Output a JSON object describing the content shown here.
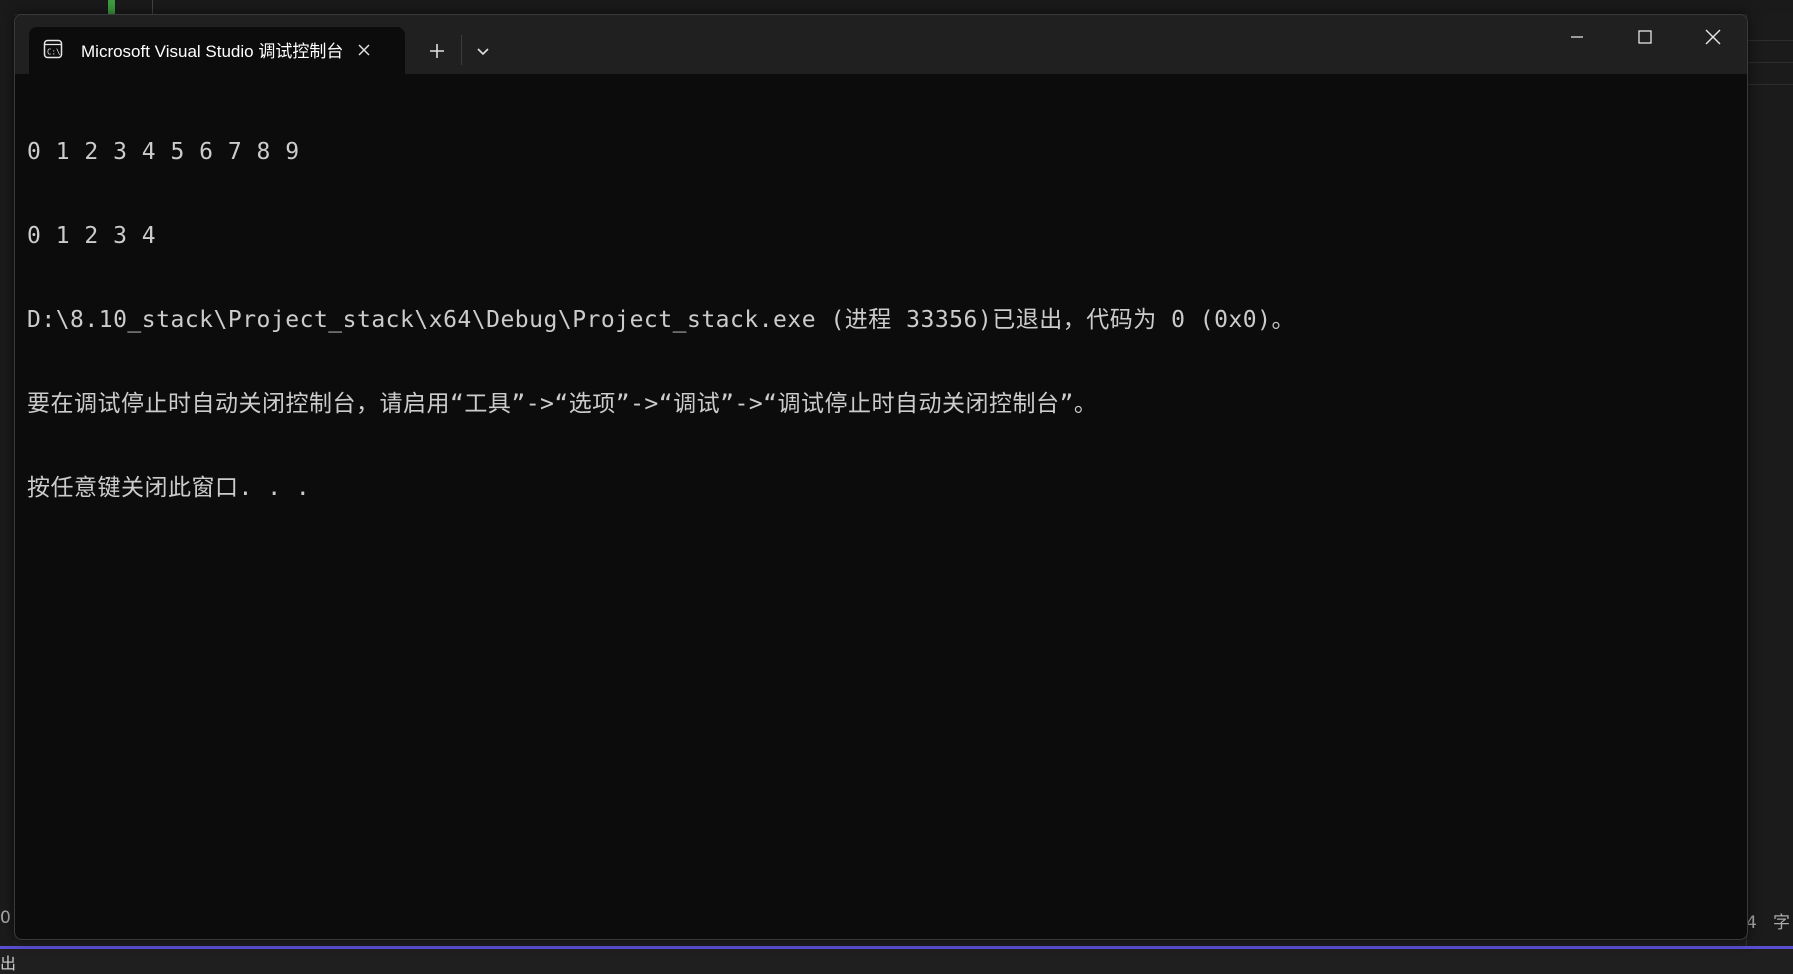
{
  "background": {
    "status_left": "0",
    "status_right": "4   字",
    "bottom_text": "出"
  },
  "window": {
    "tab": {
      "icon": "console-icon",
      "title": "Microsoft Visual Studio 调试控制台",
      "close_icon": "close-icon"
    },
    "new_tab_icon": "plus-icon",
    "dropdown_icon": "chevron-down-icon",
    "controls": {
      "minimize_icon": "minimize-icon",
      "maximize_icon": "maximize-icon",
      "close_icon": "close-icon"
    }
  },
  "console": {
    "lines": [
      "0 1 2 3 4 5 6 7 8 9",
      "0 1 2 3 4",
      "D:\\8.10_stack\\Project_stack\\x64\\Debug\\Project_stack.exe (进程 33356)已退出，代码为 0 (0x0)。",
      "要在调试停止时自动关闭控制台，请启用“工具”->“选项”->“调试”->“调试停止时自动关闭控制台”。",
      "按任意键关闭此窗口. . ."
    ]
  },
  "colors": {
    "console_bg": "#0c0c0c",
    "console_text": "#cccccc",
    "titlebar_bg": "#202020",
    "accent_bottom": "#5a4fd3"
  }
}
